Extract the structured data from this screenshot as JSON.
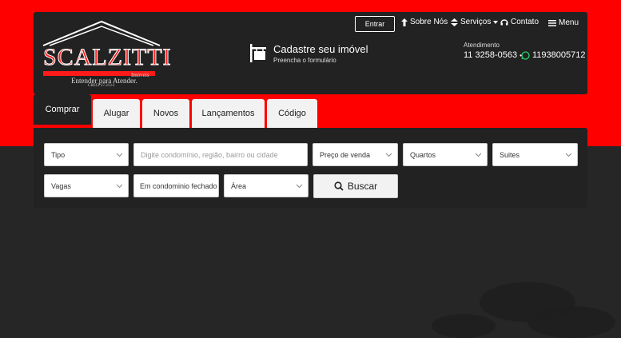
{
  "brand": {
    "name": "SCALZITTI",
    "suffix": "Imóveis",
    "tagline": "Entender para Atender.",
    "creci": "CRECI 27.213-J",
    "accent": "#ff0000"
  },
  "cadastre": {
    "icon": "house-sign-icon",
    "title": "Cadastre seu imóvel",
    "subtitle": "Preencha o formulário"
  },
  "topnav": {
    "login": "Entrar",
    "about": "Sobre Nós",
    "services": "Serviços",
    "contact": "Contato",
    "menu": "Menu"
  },
  "contact": {
    "label": "Atendimento",
    "phone": "11 3258-0563",
    "separator": "•",
    "whatsapp": "11938005712"
  },
  "tabs": {
    "comprar": "Comprar",
    "alugar": "Alugar",
    "novos": "Novos",
    "lancamentos": "Lançamentos",
    "codigo": "Código"
  },
  "search": {
    "tipo": "Tipo",
    "location_placeholder": "Digite condomínio, região, bairro ou cidade",
    "preco": "Preço de venda",
    "quartos": "Quartos",
    "suites": "Suites",
    "vagas": "Vagas",
    "condominio": "Em condominio fechado",
    "area": "Área",
    "button": "Buscar"
  }
}
